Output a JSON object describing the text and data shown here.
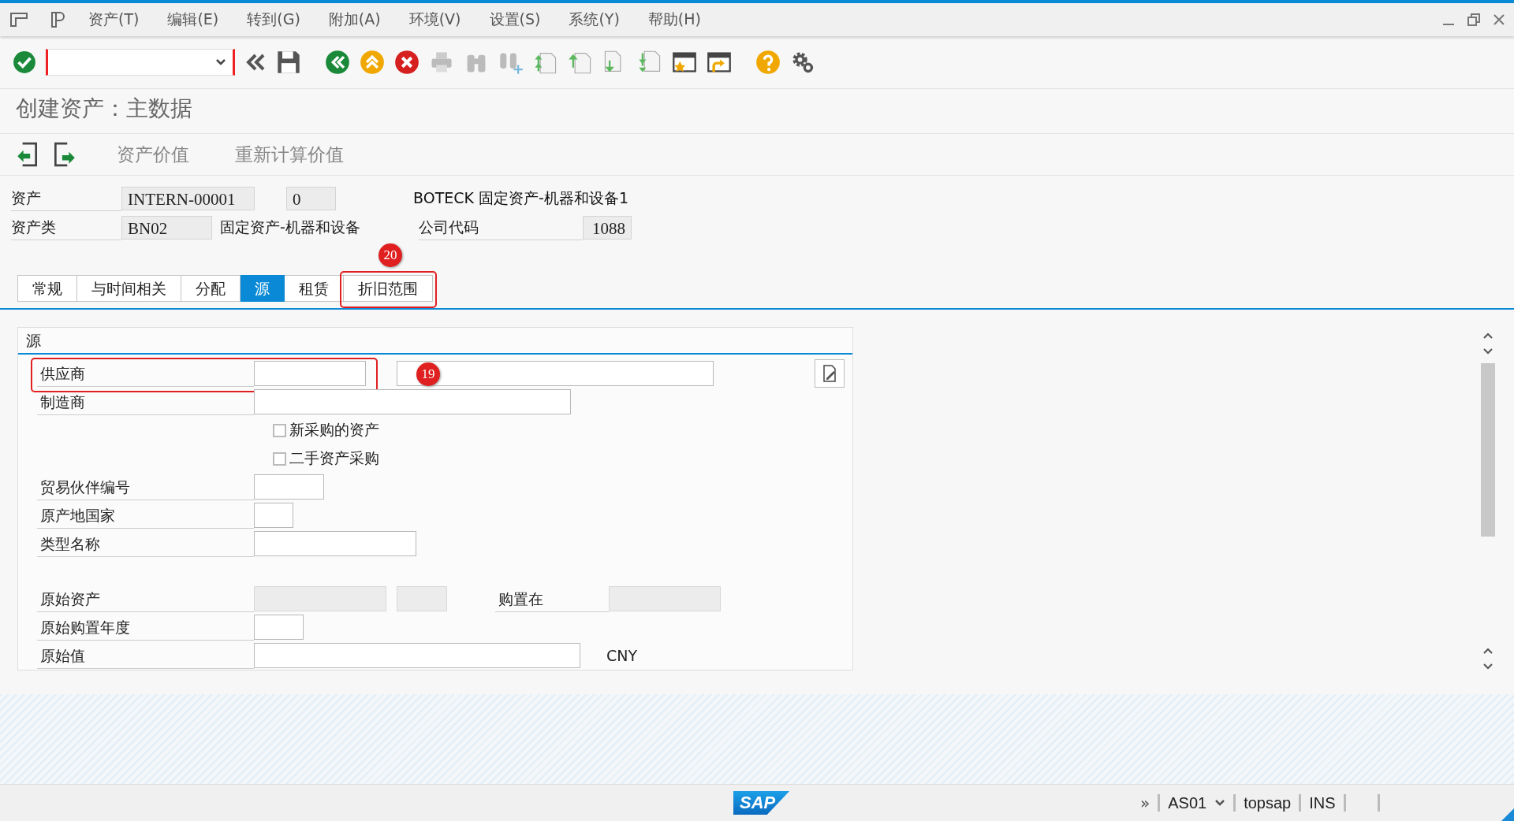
{
  "menu": [
    "资产(T)",
    "编辑(E)",
    "转到(G)",
    "附加(A)",
    "环境(V)",
    "设置(S)",
    "系统(Y)",
    "帮助(H)"
  ],
  "title": "创建资产：主数据",
  "app_toolbar": [
    "资产价值",
    "重新计算价值"
  ],
  "header": {
    "asset_label": "资产",
    "asset_number": "INTERN-00001",
    "sub_number": "0",
    "asset_description": "BOTECK 固定资产-机器和设备1",
    "class_label": "资产类",
    "asset_class": "BN02",
    "class_description": "固定资产-机器和设备",
    "company_label": "公司代码",
    "company_code": "1088"
  },
  "tabs": [
    {
      "label": "常规",
      "selected": false
    },
    {
      "label": "与时间相关",
      "selected": false
    },
    {
      "label": "分配",
      "selected": false
    },
    {
      "label": "源",
      "selected": true
    },
    {
      "label": "租赁",
      "selected": false
    },
    {
      "label": "折旧范围",
      "selected": false,
      "callout": "20"
    }
  ],
  "group": {
    "title": "源",
    "sections": [
      [
        {
          "kind": "field",
          "label": "供应商",
          "callout": "19",
          "items": [
            {
              "kind": "input",
              "disabled": false
            },
            {
              "kind": "input",
              "disabled": false
            }
          ]
        },
        {
          "kind": "field",
          "label": "制造商",
          "items": [
            {
              "kind": "input",
              "disabled": false
            }
          ]
        },
        {
          "kind": "checkbox",
          "label": "新采购的资产",
          "checked": false
        },
        {
          "kind": "checkbox",
          "label": "二手资产采购",
          "checked": false
        },
        {
          "kind": "field",
          "label": "贸易伙伴编号",
          "items": [
            {
              "kind": "input",
              "disabled": false
            }
          ]
        },
        {
          "kind": "field",
          "label": "原产地国家",
          "items": [
            {
              "kind": "input",
              "disabled": false
            }
          ]
        },
        {
          "kind": "field",
          "label": "类型名称",
          "items": [
            {
              "kind": "input",
              "disabled": false
            }
          ]
        }
      ],
      [
        {
          "kind": "field",
          "label": "原始资产",
          "items": [
            {
              "kind": "input",
              "disabled": true
            },
            {
              "kind": "input",
              "disabled": true
            },
            {
              "kind": "label",
              "text": "购置在"
            },
            {
              "kind": "input",
              "disabled": true
            }
          ]
        },
        {
          "kind": "field",
          "label": "原始购置年度",
          "items": [
            {
              "kind": "input",
              "disabled": false
            }
          ]
        },
        {
          "kind": "field",
          "label": "原始值",
          "items": [
            {
              "kind": "input",
              "disabled": false
            },
            {
              "kind": "unit",
              "text": "CNY"
            }
          ]
        }
      ]
    ]
  },
  "status_bar": {
    "logo": "SAP",
    "more": "»",
    "system": "AS01",
    "user": "topsap",
    "mode": "INS"
  }
}
